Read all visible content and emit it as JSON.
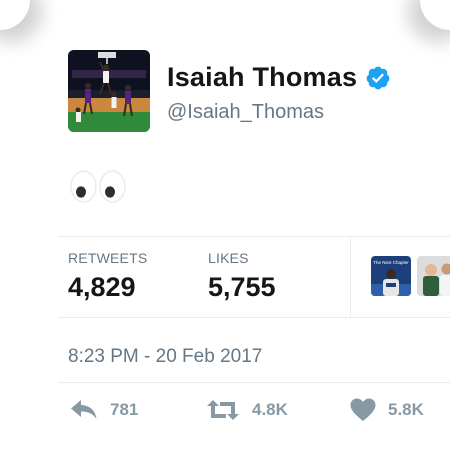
{
  "profile": {
    "name": "Isaiah Thomas",
    "handle": "@Isaiah_Thomas",
    "verified": true
  },
  "tweet": {
    "text_emoji": "eyes"
  },
  "stats": {
    "retweets_label": "RETWEETS",
    "retweets_value": "4,829",
    "likes_label": "LIKES",
    "likes_value": "5,755",
    "likers_preview": [
      {
        "caption": "The Next Chapter"
      },
      {
        "caption": ""
      }
    ]
  },
  "timestamp": "8:23 PM - 20 Feb 2017",
  "actions": {
    "reply_count": "781",
    "retweet_count": "4.8K",
    "like_count": "5.8K"
  },
  "colors": {
    "text": "#14171a",
    "muted": "#657786",
    "icon": "#8899a6",
    "verified": "#1da1f2",
    "divider": "#e6ecf0"
  }
}
